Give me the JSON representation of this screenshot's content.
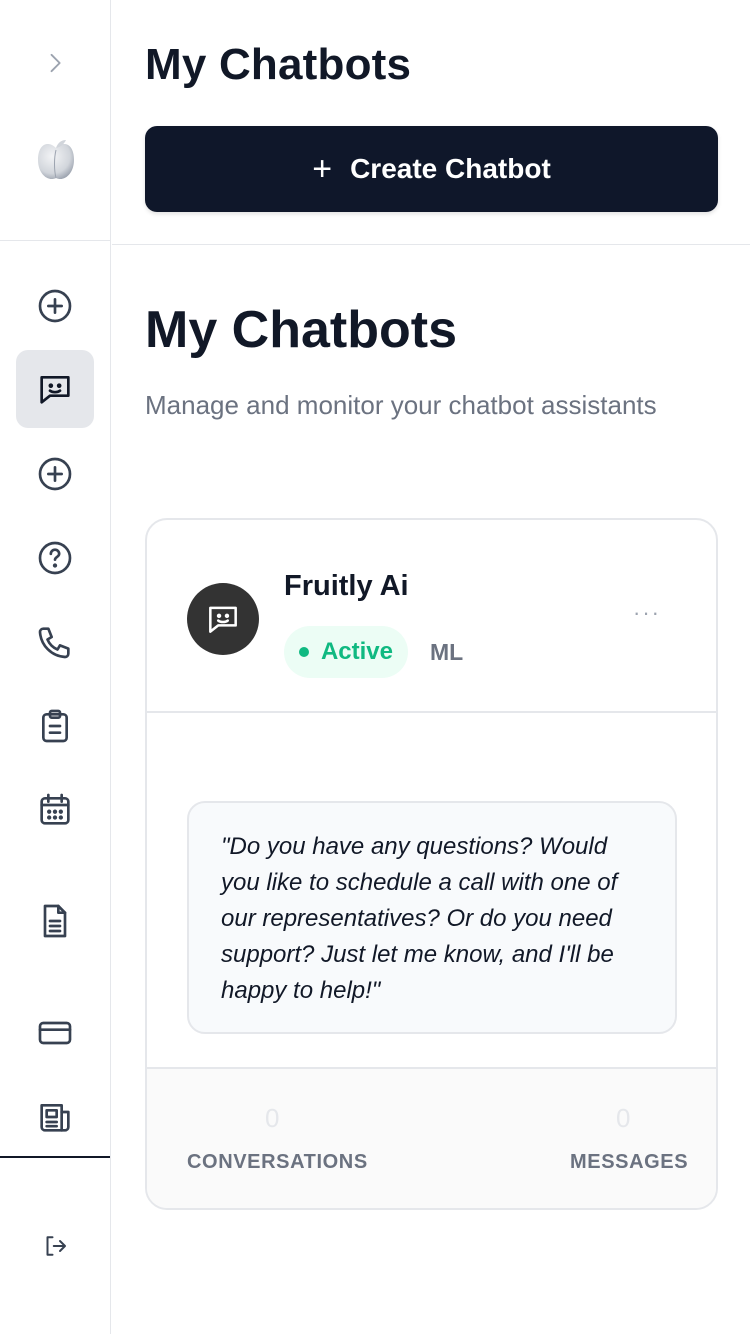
{
  "sidebar": {
    "items": [
      {
        "name": "plus-circle-icon"
      },
      {
        "name": "chat-bot-icon",
        "active": true
      },
      {
        "name": "plus-circle-icon"
      },
      {
        "name": "help-circle-icon"
      },
      {
        "name": "phone-icon"
      },
      {
        "name": "clipboard-icon"
      },
      {
        "name": "calendar-icon"
      },
      {
        "name": "document-icon"
      },
      {
        "name": "credit-card-icon"
      },
      {
        "name": "newspaper-icon"
      },
      {
        "name": "logout-icon"
      }
    ]
  },
  "header": {
    "title": "My Chatbots",
    "create_button_label": "Create Chatbot",
    "create_button_icon": "plus-icon"
  },
  "page": {
    "title": "My Chatbots",
    "subtitle": "Manage and monitor your chatbot assistants"
  },
  "chatbot": {
    "name": "Fruitly Ai",
    "status": "Active",
    "model": "ML",
    "more_icon": "ellipsis-icon",
    "greeting": "\"Do you have any questions? Would you like to schedule a call with one of our representatives? Or do you need support? Just let me know, and I'll be happy to help!\"",
    "stats": {
      "conversations_value": "0",
      "conversations_label": "CONVERSATIONS",
      "messages_value": "0",
      "messages_label": "MESSAGES"
    }
  },
  "colors": {
    "primary_button": "#0f172a",
    "status_green": "#10b981",
    "status_bg": "#ecfdf5",
    "avatar_bg": "#333333"
  }
}
